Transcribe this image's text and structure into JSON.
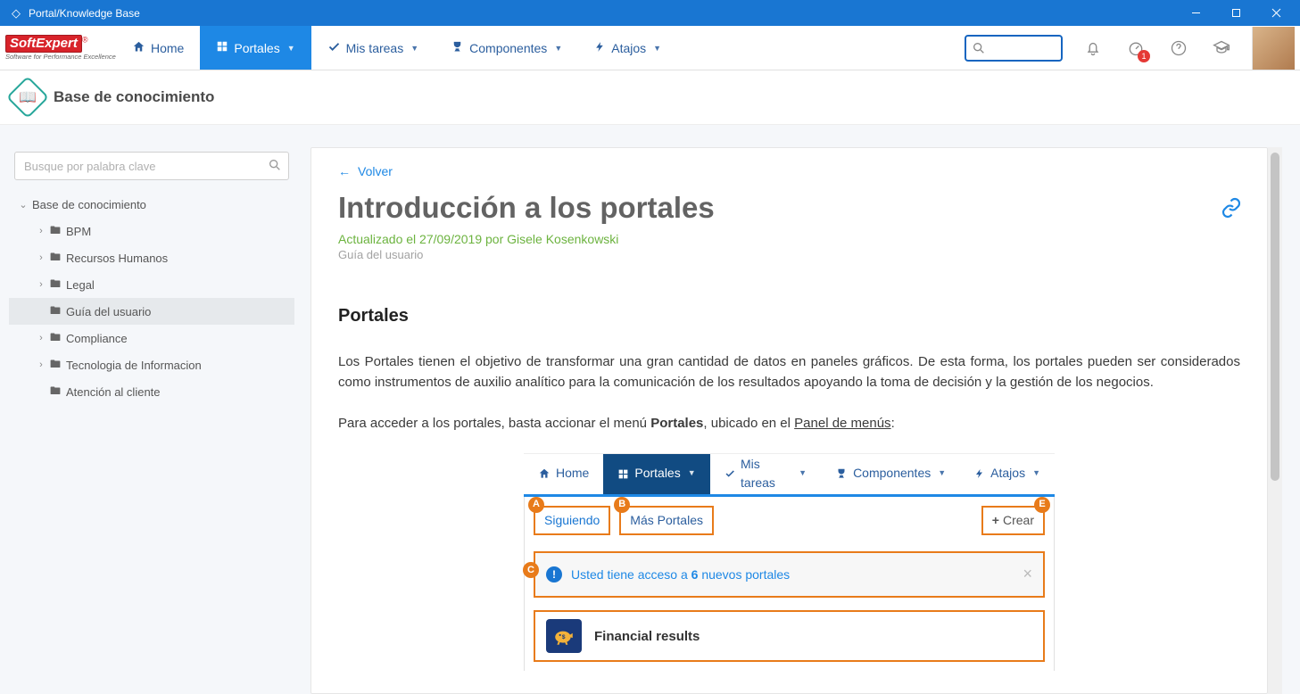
{
  "window": {
    "title": "Portal/Knowledge Base"
  },
  "logo": {
    "brand_soft": "Soft",
    "brand_expert": "Expert",
    "tagline": "Software for Performance Excellence"
  },
  "nav": {
    "home": "Home",
    "portales": "Portales",
    "mistareas": "Mis tareas",
    "componentes": "Componentes",
    "atajos": "Atajos"
  },
  "notifications": {
    "badge": "1"
  },
  "page": {
    "title": "Base de conocimiento"
  },
  "sidebar": {
    "search_placeholder": "Busque por palabra clave",
    "root": "Base de conocimiento",
    "items": [
      {
        "label": "BPM",
        "expandable": true
      },
      {
        "label": "Recursos Humanos",
        "expandable": true
      },
      {
        "label": "Legal",
        "expandable": true
      },
      {
        "label": "Guía del usuario",
        "expandable": false,
        "selected": true
      },
      {
        "label": "Compliance",
        "expandable": true
      },
      {
        "label": "Tecnologia de Informacion",
        "expandable": true
      },
      {
        "label": "Atención al cliente",
        "expandable": false
      }
    ]
  },
  "article": {
    "back": "Volver",
    "title": "Introducción a los portales",
    "meta": "Actualizado el 27/09/2019 por Gisele Kosenkowski",
    "category": "Guía del usuario",
    "h2": "Portales",
    "p1": "Los Portales tienen el objetivo de transformar una gran cantidad de datos en paneles gráficos. De esta forma, los portales pueden ser considerados como instrumentos de auxilio analítico para la comunicación de los resultados apoyando la toma de decisión y la gestión de los negocios.",
    "p2_a": "Para acceder a los portales, basta accionar el menú ",
    "p2_b": "Portales",
    "p2_c": ", ubicado en el ",
    "p2_d": "Panel de menús",
    "p2_e": ":"
  },
  "embed": {
    "nav": {
      "home": "Home",
      "portales": "Portales",
      "mistareas": "Mis tareas",
      "componentes": "Componentes",
      "atajos": "Atajos"
    },
    "tabs": {
      "a_letter": "A",
      "a_label": "Siguiendo",
      "b_letter": "B",
      "b_label": "Más Portales",
      "e_letter": "E",
      "e_label": "Crear"
    },
    "notice": {
      "c_letter": "C",
      "text_a": "Usted tiene acceso a ",
      "count": "6",
      "text_b": " nuevos portales"
    },
    "row": {
      "title": "Financial results"
    }
  }
}
